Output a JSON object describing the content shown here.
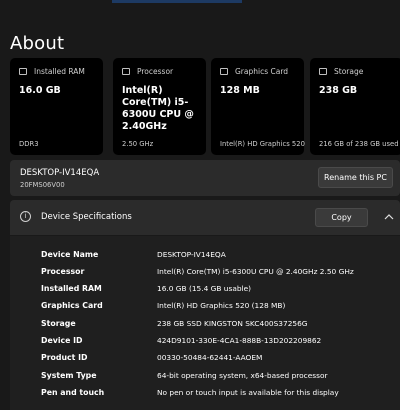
{
  "page": {
    "title": "About"
  },
  "cards": [
    {
      "icon": "memory-icon",
      "label": "Installed RAM",
      "value": "16.0 GB",
      "sub": "DDR3"
    },
    {
      "icon": "processor-icon",
      "label": "Processor",
      "value": "Intel(R) Core(TM) i5-6300U CPU @ 2.40GHz",
      "sub": "2.50 GHz"
    },
    {
      "icon": "graphics-card-icon",
      "label": "Graphics Card",
      "value": "128 MB",
      "sub": "Intel(R) HD Graphics 520"
    },
    {
      "icon": "storage-icon",
      "label": "Storage",
      "value": "238 GB",
      "sub": "216 GB of 238 GB used"
    }
  ],
  "device": {
    "name": "DESKTOP-IV14EQA",
    "model": "20FMS06V00",
    "rename_label": "Rename this PC"
  },
  "specs": {
    "title": "Device Specifications",
    "copy_label": "Copy",
    "rows": [
      {
        "key": "Device Name",
        "value": "DESKTOP-IV14EQA"
      },
      {
        "key": "Processor",
        "value": "Intel(R) Core(TM) i5-6300U CPU @ 2.40GHz   2.50 GHz"
      },
      {
        "key": "Installed RAM",
        "value": "16.0 GB (15.4 GB usable)"
      },
      {
        "key": "Graphics Card",
        "value": "Intel(R) HD Graphics 520 (128 MB)"
      },
      {
        "key": "Storage",
        "value": "238 GB SSD KINGSTON SKC400S37256G"
      },
      {
        "key": "Device ID",
        "value": "424D9101-330E-4CA1-888B-13D202209862"
      },
      {
        "key": "Product ID",
        "value": "00330-50484-62441-AAOEM"
      },
      {
        "key": "System Type",
        "value": "64-bit operating system, x64-based processor"
      },
      {
        "key": "Pen and touch",
        "value": "No pen or touch input is available for this display"
      }
    ]
  }
}
